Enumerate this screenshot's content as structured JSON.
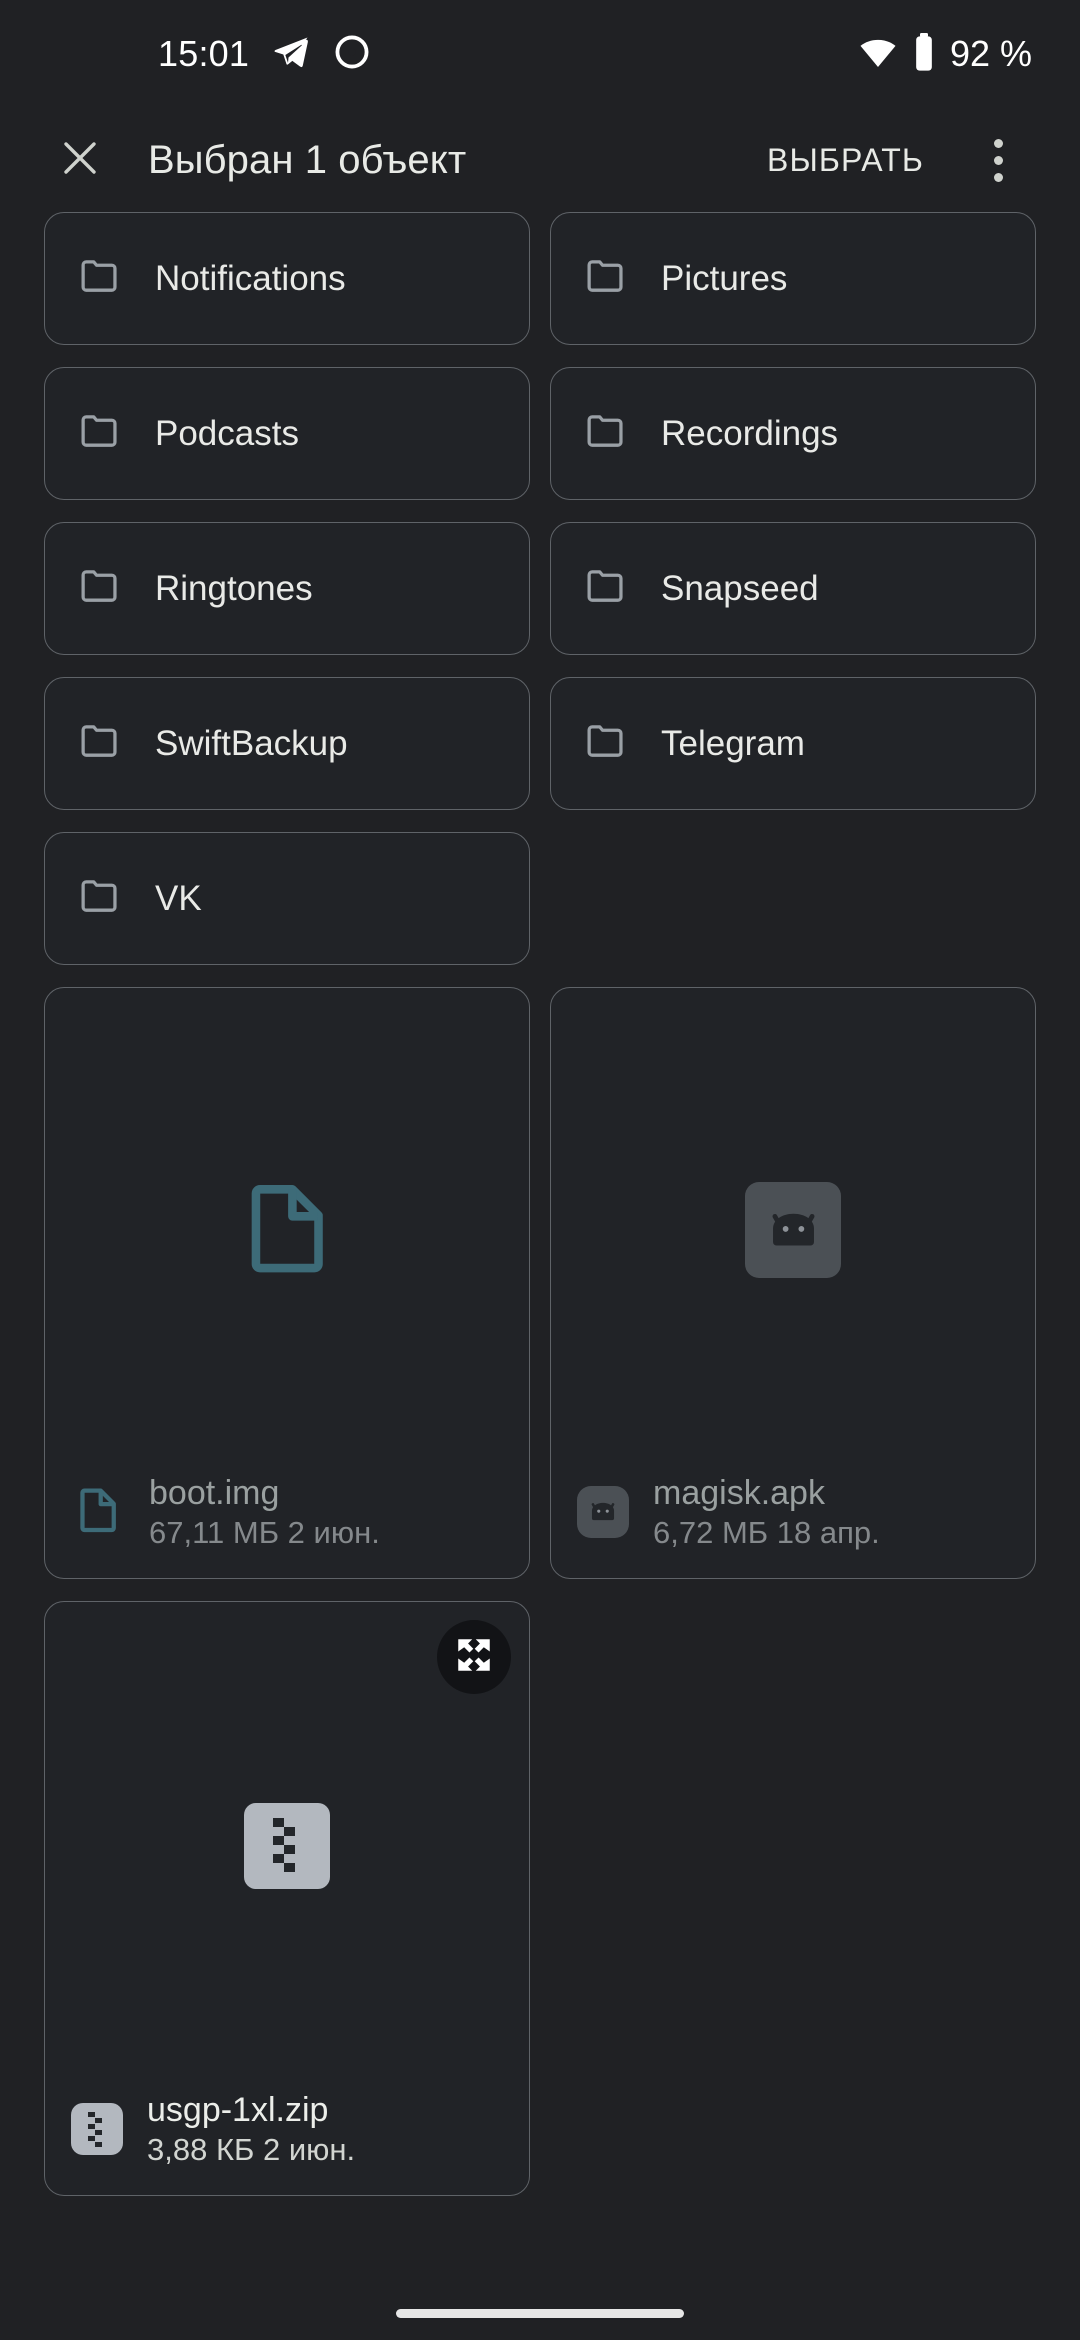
{
  "status_bar": {
    "time": "15:01",
    "battery_text": "92 %",
    "icons": [
      "telegram-icon",
      "app-icon",
      "wifi-icon",
      "battery-icon"
    ]
  },
  "app_bar": {
    "close_icon": "close-icon",
    "title": "Выбран 1 объект",
    "action_label": "ВЫБРАТЬ",
    "overflow_icon": "more-vertical-icon"
  },
  "folders": [
    {
      "name": "Notifications",
      "icon": "folder-icon"
    },
    {
      "name": "Pictures",
      "icon": "folder-icon"
    },
    {
      "name": "Podcasts",
      "icon": "folder-icon"
    },
    {
      "name": "Recordings",
      "icon": "folder-icon"
    },
    {
      "name": "Ringtones",
      "icon": "folder-icon"
    },
    {
      "name": "Snapseed",
      "icon": "folder-icon"
    },
    {
      "name": "SwiftBackup",
      "icon": "folder-icon"
    },
    {
      "name": "Telegram",
      "icon": "folder-icon"
    },
    {
      "name": "VK",
      "icon": "folder-icon"
    }
  ],
  "files": [
    {
      "name": "boot.img",
      "meta": "67,11 МБ 2 июн.",
      "icon": "document-icon",
      "selected": false
    },
    {
      "name": "magisk.apk",
      "meta": "6,72 МБ 18 апр.",
      "icon": "android-apk-icon",
      "selected": false
    },
    {
      "name": "usgp-1xl.zip",
      "meta": "3,88 КБ 2 июн.",
      "icon": "zip-archive-icon",
      "selected": true,
      "badge_icon": "expand-fullscreen-icon"
    }
  ],
  "colors": {
    "background": "#202124",
    "card_border": "#5f6368",
    "accent_teal": "#3d6b78",
    "text_primary": "#e9eae7",
    "text_secondary": "#9aa0a0"
  }
}
